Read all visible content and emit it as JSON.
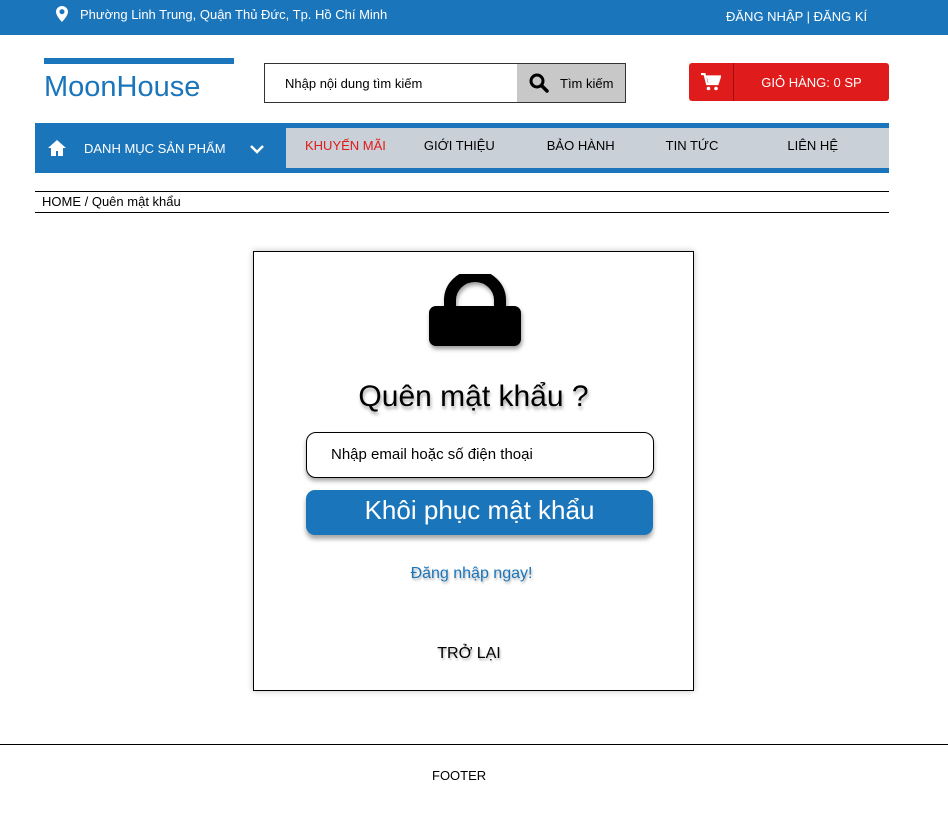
{
  "topbar": {
    "address": "Phường Linh Trung, Quận Thủ Đức, Tp. Hồ Chí Minh",
    "login": "ĐĂNG NHẬP",
    "separator": " | ",
    "register": "ĐĂNG KÍ",
    "icon": "location-pin-icon"
  },
  "header": {
    "logo": "MoonHouse",
    "search_placeholder": "Nhập nội dung tìm kiếm",
    "search_button": "Tìm kiếm",
    "cart_label": "GIỎ HÀNG: 0 SP"
  },
  "nav": {
    "category_label": "DANH MỤC SẢN PHẨM",
    "items": [
      {
        "label": "KHUYẾN MÃI"
      },
      {
        "label": "GIỚI THIỆU"
      },
      {
        "label": "BẢO HÀNH"
      },
      {
        "label": "TIN TỨC"
      },
      {
        "label": "LIÊN HỆ"
      }
    ]
  },
  "breadcrumb": {
    "home": "HOME",
    "separator": " / ",
    "current": "Quên mật khẩu"
  },
  "form": {
    "title": "Quên mật khẩu ?",
    "email_placeholder": "Nhập email hoặc số điện thoại",
    "submit_label": "Khôi phục mật khẩu",
    "login_link": "Đăng nhập ngay!",
    "back_label": "TRỞ LẠI"
  },
  "footer": {
    "label": "FOOTER"
  },
  "colors": {
    "primary": "#1a75bb",
    "cart": "#e01b1b",
    "promo": "#e01b1b",
    "menu_bg": "#c9d0d8"
  }
}
